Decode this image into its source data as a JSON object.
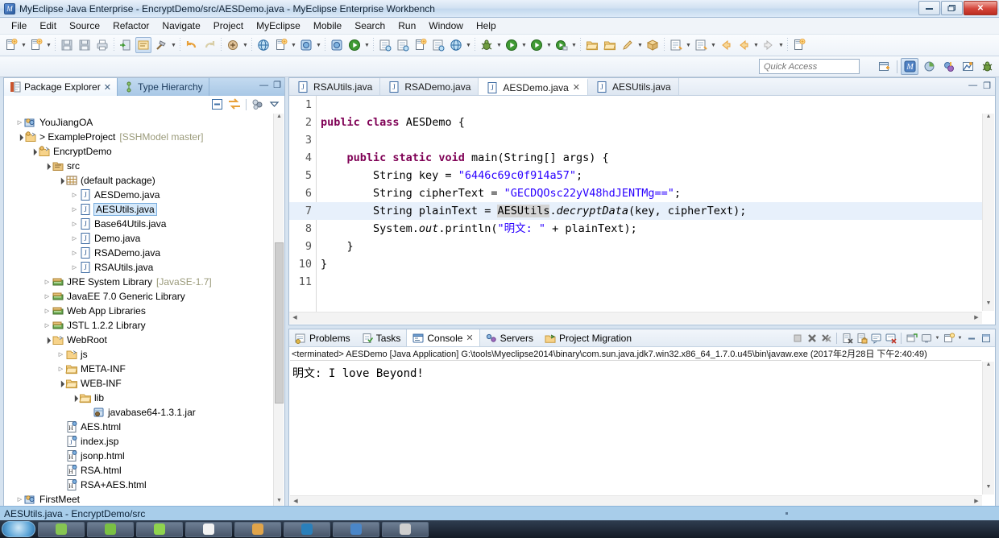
{
  "window": {
    "title": "MyEclipse Java Enterprise - EncryptDemo/src/AESDemo.java - MyEclipse Enterprise Workbench",
    "app_icon": "myeclipse-icon",
    "minimize_label": "—",
    "maximize_label": "❐",
    "close_label": "✕"
  },
  "menubar": {
    "items": [
      {
        "label": "File",
        "name": "menu-file"
      },
      {
        "label": "Edit",
        "name": "menu-edit"
      },
      {
        "label": "Source",
        "name": "menu-source"
      },
      {
        "label": "Refactor",
        "name": "menu-refactor"
      },
      {
        "label": "Navigate",
        "name": "menu-navigate"
      },
      {
        "label": "Project",
        "name": "menu-project"
      },
      {
        "label": "MyEclipse",
        "name": "menu-myeclipse"
      },
      {
        "label": "Mobile",
        "name": "menu-mobile"
      },
      {
        "label": "Search",
        "name": "menu-search"
      },
      {
        "label": "Run",
        "name": "menu-run"
      },
      {
        "label": "Window",
        "name": "menu-window"
      },
      {
        "label": "Help",
        "name": "menu-help"
      }
    ]
  },
  "toolbar": {
    "items": [
      {
        "name": "new-wizard-icon",
        "arrow": true
      },
      {
        "name": "new-project-icon",
        "arrow": true
      },
      {
        "sep": true
      },
      {
        "name": "save-icon"
      },
      {
        "name": "save-all-icon"
      },
      {
        "name": "print-icon"
      },
      {
        "sep": true
      },
      {
        "name": "export-icon"
      },
      {
        "name": "toggle-breadcrumb-icon",
        "active": true
      },
      {
        "name": "build-hammer-icon",
        "arrow": true
      },
      {
        "sep": true
      },
      {
        "name": "undo-icon"
      },
      {
        "name": "redo-icon"
      },
      {
        "sep": true
      },
      {
        "name": "deploy-icon",
        "arrow": true
      },
      {
        "sep": true
      },
      {
        "name": "open-web-browser-icon"
      },
      {
        "name": "new-server-icon",
        "arrow": true
      },
      {
        "name": "manage-server-icon",
        "arrow": true
      },
      {
        "sep": true
      },
      {
        "name": "publish-icon"
      },
      {
        "name": "run-server-icon",
        "arrow": true
      },
      {
        "sep": true
      },
      {
        "name": "open-type-icon"
      },
      {
        "name": "open-resource-icon"
      },
      {
        "name": "new-jsp-icon"
      },
      {
        "name": "preferences-icon"
      },
      {
        "name": "web-browser-icon",
        "arrow": true
      },
      {
        "sep": true
      },
      {
        "name": "debug-icon",
        "arrow": true
      },
      {
        "name": "run-icon",
        "arrow": true
      },
      {
        "name": "run-config-icon",
        "arrow": true
      },
      {
        "name": "coverage-icon",
        "arrow": true
      },
      {
        "sep": true
      },
      {
        "name": "open-folder-icon"
      },
      {
        "name": "open-folder-2-icon"
      },
      {
        "name": "pencil-icon",
        "arrow": true
      },
      {
        "name": "package-icon"
      },
      {
        "sep": true
      },
      {
        "name": "next-annotation-icon",
        "arrow": true
      },
      {
        "name": "previous-annotation-icon",
        "arrow": true
      },
      {
        "name": "back-star-icon"
      },
      {
        "name": "back-icon",
        "arrow": true
      },
      {
        "name": "forward-icon",
        "arrow": true
      },
      {
        "sep": true
      },
      {
        "name": "new-window-icon"
      }
    ]
  },
  "quick_access": {
    "placeholder": "Quick Access",
    "value": "",
    "new-perspective-label": "new-perspective-icon",
    "perspectives": [
      {
        "name": "perspective-myeclipse-java-enterprise",
        "selected": true
      },
      {
        "name": "perspective-resource",
        "selected": false
      },
      {
        "name": "perspective-java-ee",
        "selected": false
      },
      {
        "name": "perspective-java",
        "selected": false
      },
      {
        "name": "perspective-debug",
        "selected": false
      }
    ]
  },
  "package_explorer": {
    "tabs": [
      {
        "label": "Package Explorer",
        "icon": "package-explorer-icon",
        "active": true,
        "closable": true
      },
      {
        "label": "Type Hierarchy",
        "icon": "type-hierarchy-icon",
        "active": false,
        "closable": false
      }
    ],
    "view_minimize": "—",
    "view_maximize": "❐",
    "toolbar": [
      {
        "name": "collapse-all-icon"
      },
      {
        "name": "link-with-editor-icon"
      },
      {
        "name": "view-menu-filter-icon"
      },
      {
        "name": "view-menu-icon"
      }
    ],
    "tree": [
      {
        "indent": 1,
        "twisty": "collapsed",
        "icon": "java-project-icon",
        "label": "YouJiangOA",
        "dim": ""
      },
      {
        "indent": 1,
        "twisty": "expanded",
        "icon": "web-project-icon",
        "label": "> ExampleProject",
        "dim": "[SSHModel master]"
      },
      {
        "indent": 2,
        "twisty": "expanded",
        "icon": "web-project-icon",
        "label": "EncryptDemo",
        "dim": ""
      },
      {
        "indent": 3,
        "twisty": "expanded",
        "icon": "source-folder-icon",
        "label": "src",
        "dim": ""
      },
      {
        "indent": 4,
        "twisty": "expanded",
        "icon": "package-icon",
        "label": "(default package)",
        "dim": ""
      },
      {
        "indent": 5,
        "twisty": "collapsed",
        "icon": "java-file-icon",
        "label": "AESDemo.java",
        "dim": ""
      },
      {
        "indent": 5,
        "twisty": "collapsed",
        "icon": "java-file-icon",
        "label": "AESUtils.java",
        "dim": "",
        "selected": true
      },
      {
        "indent": 5,
        "twisty": "collapsed",
        "icon": "java-file-icon",
        "label": "Base64Utils.java",
        "dim": ""
      },
      {
        "indent": 5,
        "twisty": "collapsed",
        "icon": "java-file-icon",
        "label": "Demo.java",
        "dim": ""
      },
      {
        "indent": 5,
        "twisty": "collapsed",
        "icon": "java-file-icon",
        "label": "RSADemo.java",
        "dim": ""
      },
      {
        "indent": 5,
        "twisty": "collapsed",
        "icon": "java-file-icon",
        "label": "RSAUtils.java",
        "dim": ""
      },
      {
        "indent": 3,
        "twisty": "collapsed",
        "icon": "library-icon",
        "label": "JRE System Library",
        "dim": "[JavaSE-1.7]"
      },
      {
        "indent": 3,
        "twisty": "collapsed",
        "icon": "library-icon",
        "label": "JavaEE 7.0 Generic Library",
        "dim": ""
      },
      {
        "indent": 3,
        "twisty": "collapsed",
        "icon": "library-icon",
        "label": "Web App Libraries",
        "dim": ""
      },
      {
        "indent": 3,
        "twisty": "collapsed",
        "icon": "library-icon",
        "label": "JSTL 1.2.2 Library",
        "dim": ""
      },
      {
        "indent": 3,
        "twisty": "expanded",
        "icon": "webroot-folder-icon",
        "label": "WebRoot",
        "dim": ""
      },
      {
        "indent": 4,
        "twisty": "collapsed",
        "icon": "webroot-folder-icon",
        "label": "js",
        "dim": ""
      },
      {
        "indent": 4,
        "twisty": "collapsed",
        "icon": "folder-icon",
        "label": "META-INF",
        "dim": ""
      },
      {
        "indent": 4,
        "twisty": "expanded",
        "icon": "folder-icon",
        "label": "WEB-INF",
        "dim": ""
      },
      {
        "indent": 5,
        "twisty": "expanded",
        "icon": "folder-icon",
        "label": "lib",
        "dim": ""
      },
      {
        "indent": 6,
        "twisty": "none",
        "icon": "jar-icon",
        "label": "javabase64-1.3.1.jar",
        "dim": ""
      },
      {
        "indent": 4,
        "twisty": "none",
        "icon": "html-file-icon",
        "label": "AES.html",
        "dim": ""
      },
      {
        "indent": 4,
        "twisty": "none",
        "icon": "jsp-file-icon",
        "label": "index.jsp",
        "dim": ""
      },
      {
        "indent": 4,
        "twisty": "none",
        "icon": "html-file-icon",
        "label": "jsonp.html",
        "dim": ""
      },
      {
        "indent": 4,
        "twisty": "none",
        "icon": "html-file-icon",
        "label": "RSA.html",
        "dim": ""
      },
      {
        "indent": 4,
        "twisty": "none",
        "icon": "html-file-icon",
        "label": "RSA+AES.html",
        "dim": ""
      },
      {
        "indent": 1,
        "twisty": "collapsed",
        "icon": "java-project-icon",
        "label": "FirstMeet",
        "dim": ""
      }
    ]
  },
  "editor": {
    "tabs": [
      {
        "label": "RSAUtils.java",
        "icon": "java-file-icon",
        "active": false,
        "closable": false
      },
      {
        "label": "RSADemo.java",
        "icon": "java-file-icon",
        "active": false,
        "closable": false
      },
      {
        "label": "AESDemo.java",
        "icon": "java-file-icon",
        "active": true,
        "closable": true
      },
      {
        "label": "AESUtils.java",
        "icon": "java-file-icon",
        "active": false,
        "closable": false
      }
    ],
    "minimize_label": "—",
    "maximize_label": "❐",
    "lines": [
      {
        "n": "1",
        "segments": [],
        "highlight": false
      },
      {
        "n": "2",
        "segments": [
          {
            "t": "public ",
            "c": "kw"
          },
          {
            "t": "class ",
            "c": "kw"
          },
          {
            "t": "AESDemo {",
            "c": ""
          }
        ],
        "highlight": false
      },
      {
        "n": "3",
        "segments": [],
        "highlight": false
      },
      {
        "n": "4",
        "segments": [
          {
            "t": "    ",
            "c": ""
          },
          {
            "t": "public ",
            "c": "kw"
          },
          {
            "t": "static ",
            "c": "kw"
          },
          {
            "t": "void ",
            "c": "kw"
          },
          {
            "t": "main(String[] args) {",
            "c": ""
          }
        ],
        "highlight": false
      },
      {
        "n": "5",
        "segments": [
          {
            "t": "        String key = ",
            "c": ""
          },
          {
            "t": "\"6446c69c0f914a57\"",
            "c": "str"
          },
          {
            "t": ";",
            "c": ""
          }
        ],
        "highlight": false
      },
      {
        "n": "6",
        "segments": [
          {
            "t": "        String cipherText = ",
            "c": ""
          },
          {
            "t": "\"GECDQOsc22yV48hdJENTMg==\"",
            "c": "str"
          },
          {
            "t": ";",
            "c": ""
          }
        ],
        "highlight": false
      },
      {
        "n": "7",
        "segments": [
          {
            "t": "        String plainText = ",
            "c": ""
          },
          {
            "t": "AESUtils",
            "c": "occ"
          },
          {
            "t": ".",
            "c": ""
          },
          {
            "t": "decryptData",
            "c": "ital"
          },
          {
            "t": "(key, cipherText);",
            "c": ""
          }
        ],
        "highlight": true
      },
      {
        "n": "8",
        "segments": [
          {
            "t": "        System.",
            "c": ""
          },
          {
            "t": "out",
            "c": "ital"
          },
          {
            "t": ".println(",
            "c": ""
          },
          {
            "t": "\"明文: \"",
            "c": "str"
          },
          {
            "t": " + plainText);",
            "c": ""
          }
        ],
        "highlight": false
      },
      {
        "n": "9",
        "segments": [
          {
            "t": "    }",
            "c": ""
          }
        ],
        "highlight": false
      },
      {
        "n": "10",
        "segments": [
          {
            "t": "}",
            "c": ""
          }
        ],
        "highlight": false
      },
      {
        "n": "11",
        "segments": [],
        "highlight": false
      }
    ]
  },
  "console": {
    "tabs": [
      {
        "label": "Problems",
        "icon": "problems-icon",
        "active": false,
        "closable": false
      },
      {
        "label": "Tasks",
        "icon": "tasks-icon",
        "active": false,
        "closable": false
      },
      {
        "label": "Console",
        "icon": "console-icon",
        "active": true,
        "closable": true
      },
      {
        "label": "Servers",
        "icon": "servers-icon",
        "active": false,
        "closable": false
      },
      {
        "label": "Project Migration",
        "icon": "project-migration-icon",
        "active": false,
        "closable": false
      }
    ],
    "toolbar": [
      {
        "name": "terminate-icon"
      },
      {
        "name": "remove-launch-icon"
      },
      {
        "name": "remove-all-terminated-icon"
      },
      {
        "sep": true
      },
      {
        "name": "clear-console-icon"
      },
      {
        "name": "scroll-lock-icon"
      },
      {
        "name": "show-console-on-output-icon"
      },
      {
        "name": "pin-console-icon"
      },
      {
        "sep": true
      },
      {
        "name": "open-console-icon"
      },
      {
        "name": "display-selected-console-icon",
        "arrow": true
      },
      {
        "name": "new-console-view-icon",
        "arrow": true
      },
      {
        "name": "minimize-icon"
      },
      {
        "name": "maximize-icon"
      }
    ],
    "terminated_line": "<terminated> AESDemo [Java Application] G:\\tools\\Myeclipse2014\\binary\\com.sun.java.jdk7.win32.x86_64_1.7.0.u45\\bin\\javaw.exe (2017年2月28日 下午2:40:49)",
    "output": "明文: I love Beyond!"
  },
  "statusbar": {
    "text": "AESUtils.java - EncryptDemo/src"
  },
  "taskbar": {
    "start_label": "start-orb",
    "items": [
      {
        "name": "taskbar-item-1",
        "color": "#86c552"
      },
      {
        "name": "taskbar-item-2",
        "color": "#7ac043"
      },
      {
        "name": "taskbar-item-3",
        "color": "#8fd34e"
      },
      {
        "name": "taskbar-item-4",
        "color": "#f2f2f2"
      },
      {
        "name": "taskbar-item-5",
        "color": "#e0a44a"
      },
      {
        "name": "taskbar-item-6",
        "color": "#2a7fba"
      },
      {
        "name": "taskbar-item-7",
        "color": "#4a86c8"
      },
      {
        "name": "taskbar-item-8",
        "color": "#cfcfcf"
      }
    ]
  },
  "colors": {
    "keyword": "#7f0055",
    "string": "#2a00ff",
    "selection": "#d5e9fb",
    "line_highlight": "#e7f0fb",
    "occurrence": "#d4d4d4",
    "statusbar": "#a8cdea"
  }
}
